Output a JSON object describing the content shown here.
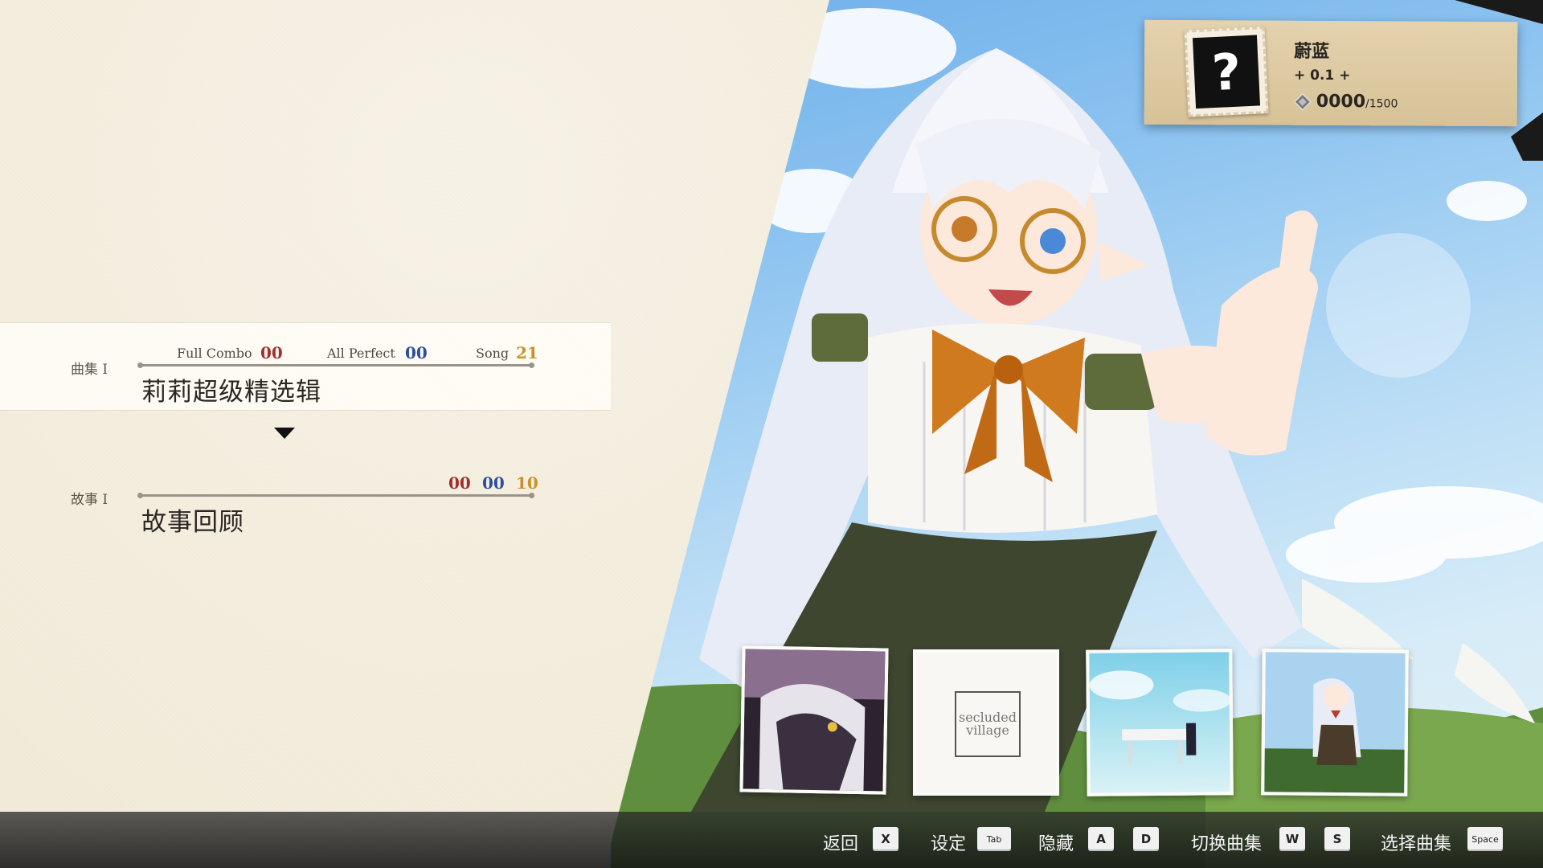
{
  "profile": {
    "avatar_symbol": "?",
    "name": "蔚蓝",
    "rating": "+ 0.1 +",
    "currency_value": "0000",
    "currency_max": "/1500"
  },
  "collection_row": {
    "tag": "曲集 I",
    "title": "莉莉超级精选辑",
    "full_combo_label": "Full Combo",
    "full_combo_value": "00",
    "all_perfect_label": "All Perfect",
    "all_perfect_value": "00",
    "song_label": "Song",
    "song_value": "21"
  },
  "story_row": {
    "tag": "故事 I",
    "title": "故事回顾",
    "value_red": "00",
    "value_blue": "00",
    "value_gold": "10"
  },
  "covers": [
    {
      "name": "cover-1",
      "text": ""
    },
    {
      "name": "cover-2",
      "text": "secluded village"
    },
    {
      "name": "cover-3",
      "text": ""
    },
    {
      "name": "cover-4",
      "text": ""
    }
  ],
  "controls": [
    {
      "label": "返回",
      "key": "X"
    },
    {
      "label": "设定",
      "key": "Tab"
    },
    {
      "label": "隐藏",
      "key_a": "A",
      "key_b": "D"
    },
    {
      "label": "切换曲集",
      "key_a": "W",
      "key_b": "S"
    },
    {
      "label": "选择曲集",
      "key": "Space"
    }
  ],
  "colors": {
    "stat_red": "#a3302c",
    "stat_blue": "#2f4f9c",
    "stat_gold": "#c8922a",
    "paper": "#f2ebd9"
  }
}
